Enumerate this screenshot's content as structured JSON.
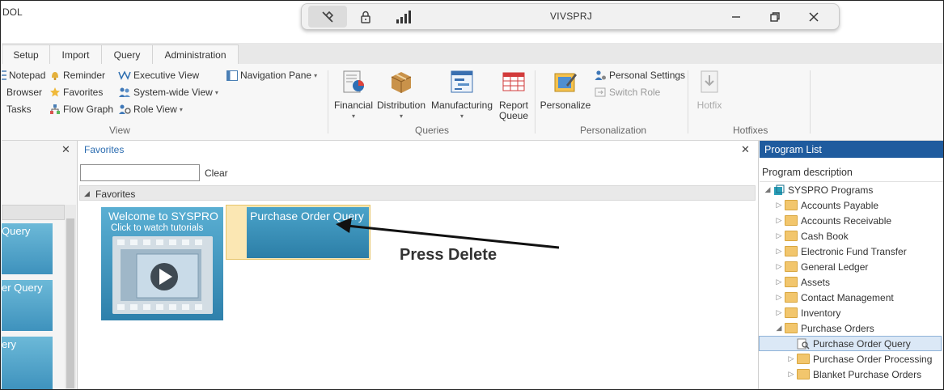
{
  "app": {
    "title_fragment": "DOL"
  },
  "remote_bar": {
    "title": "VIVSPRJ"
  },
  "tabs": [
    {
      "label": "Setup"
    },
    {
      "label": "Import"
    },
    {
      "label": "Query"
    },
    {
      "label": "Administration"
    }
  ],
  "ribbon": {
    "view": {
      "items": [
        "Notepad",
        "Browser",
        "Tasks",
        "Reminder",
        "Favorites",
        "Flow Graph",
        "Executive View",
        "System-wide View",
        "Role View",
        "Navigation Pane"
      ],
      "label": "View"
    },
    "queries": {
      "buttons": [
        "Financial",
        "Distribution",
        "Manufacturing",
        "Report",
        "Queue"
      ],
      "label": "Queries"
    },
    "personalization": {
      "personalize": "Personalize",
      "personal_settings": "Personal Settings",
      "switch_role": "Switch Role",
      "label": "Personalization"
    },
    "hotfixes": {
      "hotfix": "Hotfix",
      "label": "Hotfixes"
    }
  },
  "left_panel": {
    "tiles": [
      "Query",
      "er Query",
      "ery"
    ]
  },
  "favorites": {
    "title": "Favorites",
    "clear": "Clear",
    "search_value": "",
    "section": "Favorites",
    "welcome_title": "Welcome to SYSPRO",
    "welcome_sub": "Click to watch tutorials",
    "tile_po": "Purchase Order Query"
  },
  "annotation": {
    "text": "Press Delete"
  },
  "program_list": {
    "title": "Program List",
    "column": "Program description",
    "root": "SYSPRO Programs",
    "items": [
      "Accounts Payable",
      "Accounts Receivable",
      "Cash Book",
      "Electronic Fund Transfer",
      "General Ledger",
      "Assets",
      "Contact Management",
      "Inventory",
      "Purchase Orders"
    ],
    "sub_items": [
      "Purchase Order Query",
      "Purchase Order Processing",
      "Blanket Purchase Orders"
    ]
  },
  "colors": {
    "accent_blue": "#1f5b9e",
    "tile_blue": "#3e92bd",
    "selection_bg": "#fbe7b3"
  }
}
